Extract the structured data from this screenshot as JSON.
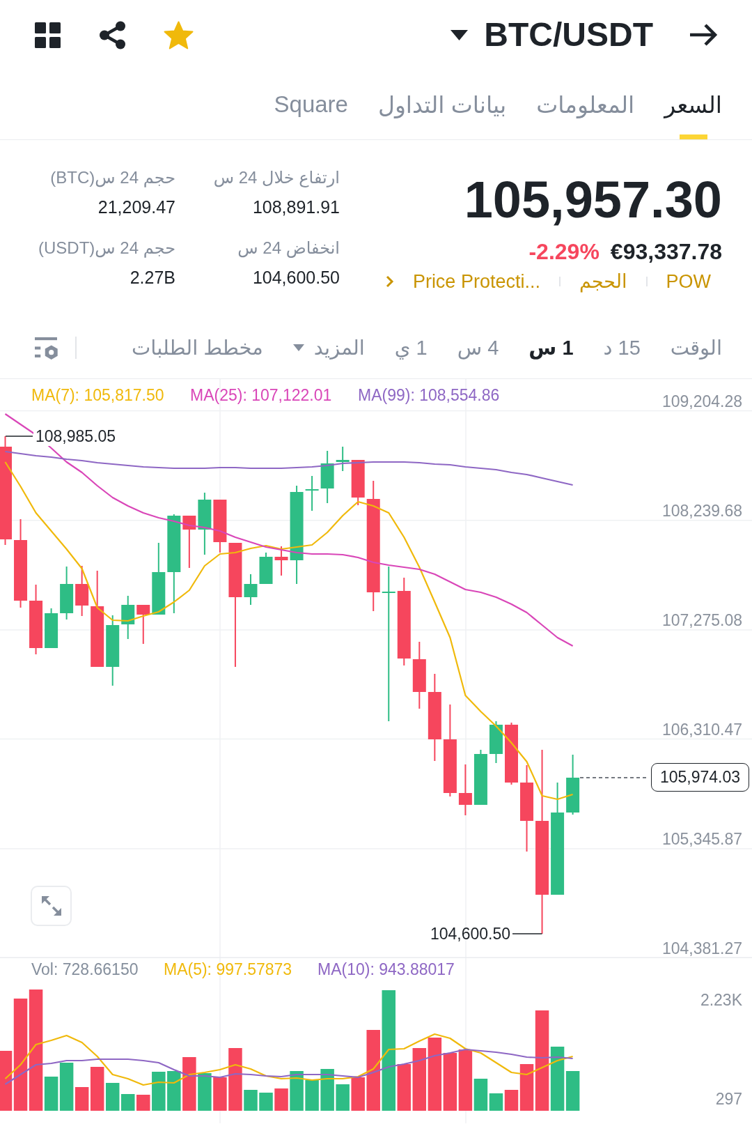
{
  "header": {
    "pair": "BTC/USDT"
  },
  "tabs": [
    {
      "label": "السعر",
      "selected": true
    },
    {
      "label": "المعلومات",
      "selected": false
    },
    {
      "label": "بيانات التداول",
      "selected": false
    },
    {
      "label": "Square",
      "selected": false
    }
  ],
  "ticker": {
    "last_price": "105,957.30",
    "change": "-2.29%",
    "fiat_price": "€93,337.78",
    "tags": [
      "POW",
      "الحجم",
      "Price Protecti..."
    ],
    "stats": [
      {
        "label": "ارتفاع خلال 24 س",
        "value": "108,891.91"
      },
      {
        "label": "حجم 24 س(BTC)",
        "value": "21,209.47"
      },
      {
        "label": "انخفاض 24 س",
        "value": "104,600.50"
      },
      {
        "label": "حجم 24 س(USDT)",
        "value": "2.27B"
      }
    ]
  },
  "intervals": [
    {
      "label": "الوقت",
      "kind": "option",
      "selected": false
    },
    {
      "label": "15 د",
      "kind": "option",
      "selected": false
    },
    {
      "label": "1 س",
      "kind": "option",
      "selected": true
    },
    {
      "label": "4 س",
      "kind": "option",
      "selected": false
    },
    {
      "label": "1 ي",
      "kind": "option",
      "selected": false
    },
    {
      "label": "المزيد",
      "kind": "dropdown",
      "selected": false
    },
    {
      "label": "مخطط الطلبات",
      "kind": "option",
      "selected": false
    }
  ],
  "chart": {
    "legend": [
      {
        "text": "MA(99): 108,554.86",
        "color": "#8e67c4"
      },
      {
        "text": "MA(25): 107,122.01",
        "color": "#d946b8"
      },
      {
        "text": "MA(7): 105,817.50",
        "color": "#f0b90b"
      }
    ],
    "price_axis": [
      "109,204.28",
      "108,239.68",
      "107,275.08",
      "106,310.47",
      "105,345.87",
      "104,381.27"
    ],
    "high_label": "108,985.05",
    "low_label": "104,600.50",
    "last_price_tag": "105,974.03"
  },
  "volume": {
    "legend": [
      {
        "text": "MA(10): 943.88017",
        "color": "#8e67c4"
      },
      {
        "text": "MA(5): 997.57873",
        "color": "#f0b90b"
      },
      {
        "text": "Vol: 728.66150",
        "color": "#848e9c"
      }
    ],
    "axis": [
      "2.23K",
      "297"
    ]
  }
}
